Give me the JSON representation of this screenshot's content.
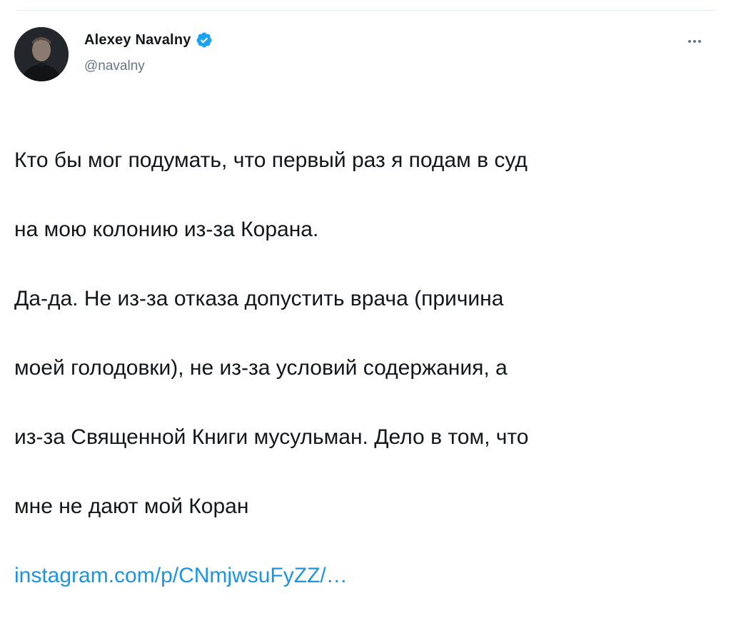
{
  "tweet": {
    "author": {
      "display_name": "Alexey Navalny",
      "handle": "@navalny",
      "verified": true,
      "avatar_icon": "profile-photo"
    },
    "more_icon": "ellipsis-icon",
    "text_lines": [
      "Кто бы мог подумать, что первый раз я подам в суд",
      "на мою колонию из-за Корана.",
      "Да-да. Не из-за отказа допустить врача (причина",
      "моей голодовки), не из-за условий содержания, а",
      "из-за Священной Книги мусульман. Дело в том, что",
      "мне не дают мой Коран"
    ],
    "link": "instagram.com/p/CNmjwsuFyZZ/…"
  },
  "colors": {
    "text": "#14171a",
    "secondary": "#657786",
    "link": "#1b95e0",
    "verified": "#1da1f2",
    "border": "#e6ecf0"
  }
}
